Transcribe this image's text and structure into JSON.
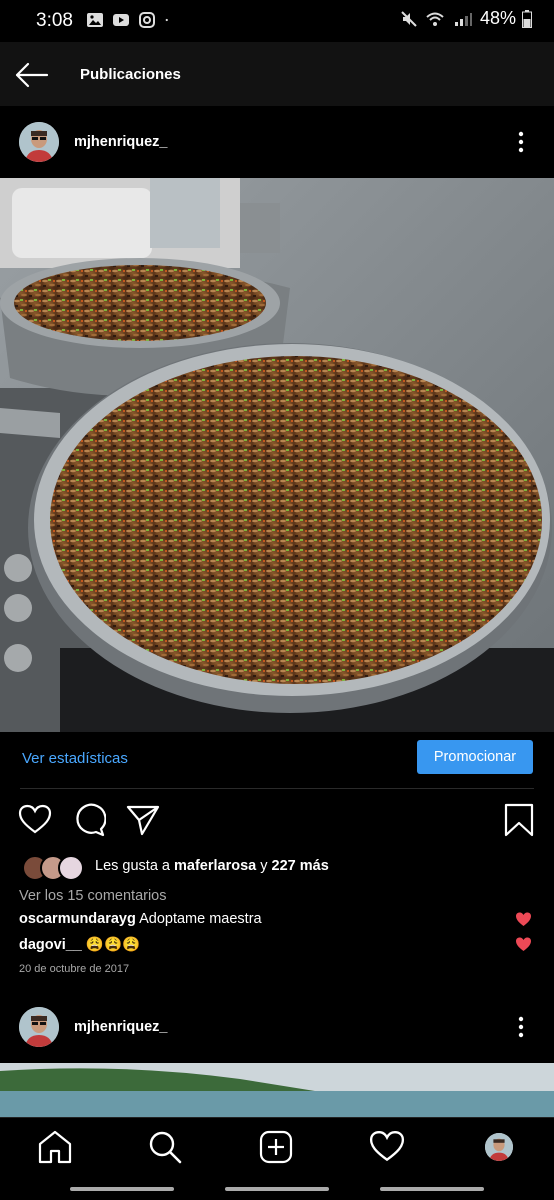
{
  "status_bar": {
    "time": "3:08",
    "battery": "48%"
  },
  "header": {
    "title": "Publicaciones"
  },
  "post": {
    "username": "mjhenriquez_",
    "stats_link": "Ver estadísticas",
    "promote_label": "Promocionar",
    "likes": {
      "prefix": "Les gusta a ",
      "user": "maferlarosa",
      "connector": " y ",
      "count": "227 más"
    },
    "view_comments": "Ver los 15 comentarios",
    "comments": [
      {
        "user": "oscarmundarayg",
        "text": "Adoptame maestra"
      },
      {
        "user": "dagovi__",
        "text": "😩😩😩"
      }
    ],
    "date": "20 de octubre de 2017"
  },
  "next_post": {
    "username": "mjhenriquez_"
  },
  "colors": {
    "accent": "#3897f0",
    "link": "#4aa8ff",
    "like_red": "#ed4956"
  },
  "icons": [
    "back-arrow-icon",
    "more-icon",
    "heart-icon",
    "comment-icon",
    "send-icon",
    "bookmark-icon",
    "home-icon",
    "search-icon",
    "add-icon",
    "activity-icon"
  ]
}
